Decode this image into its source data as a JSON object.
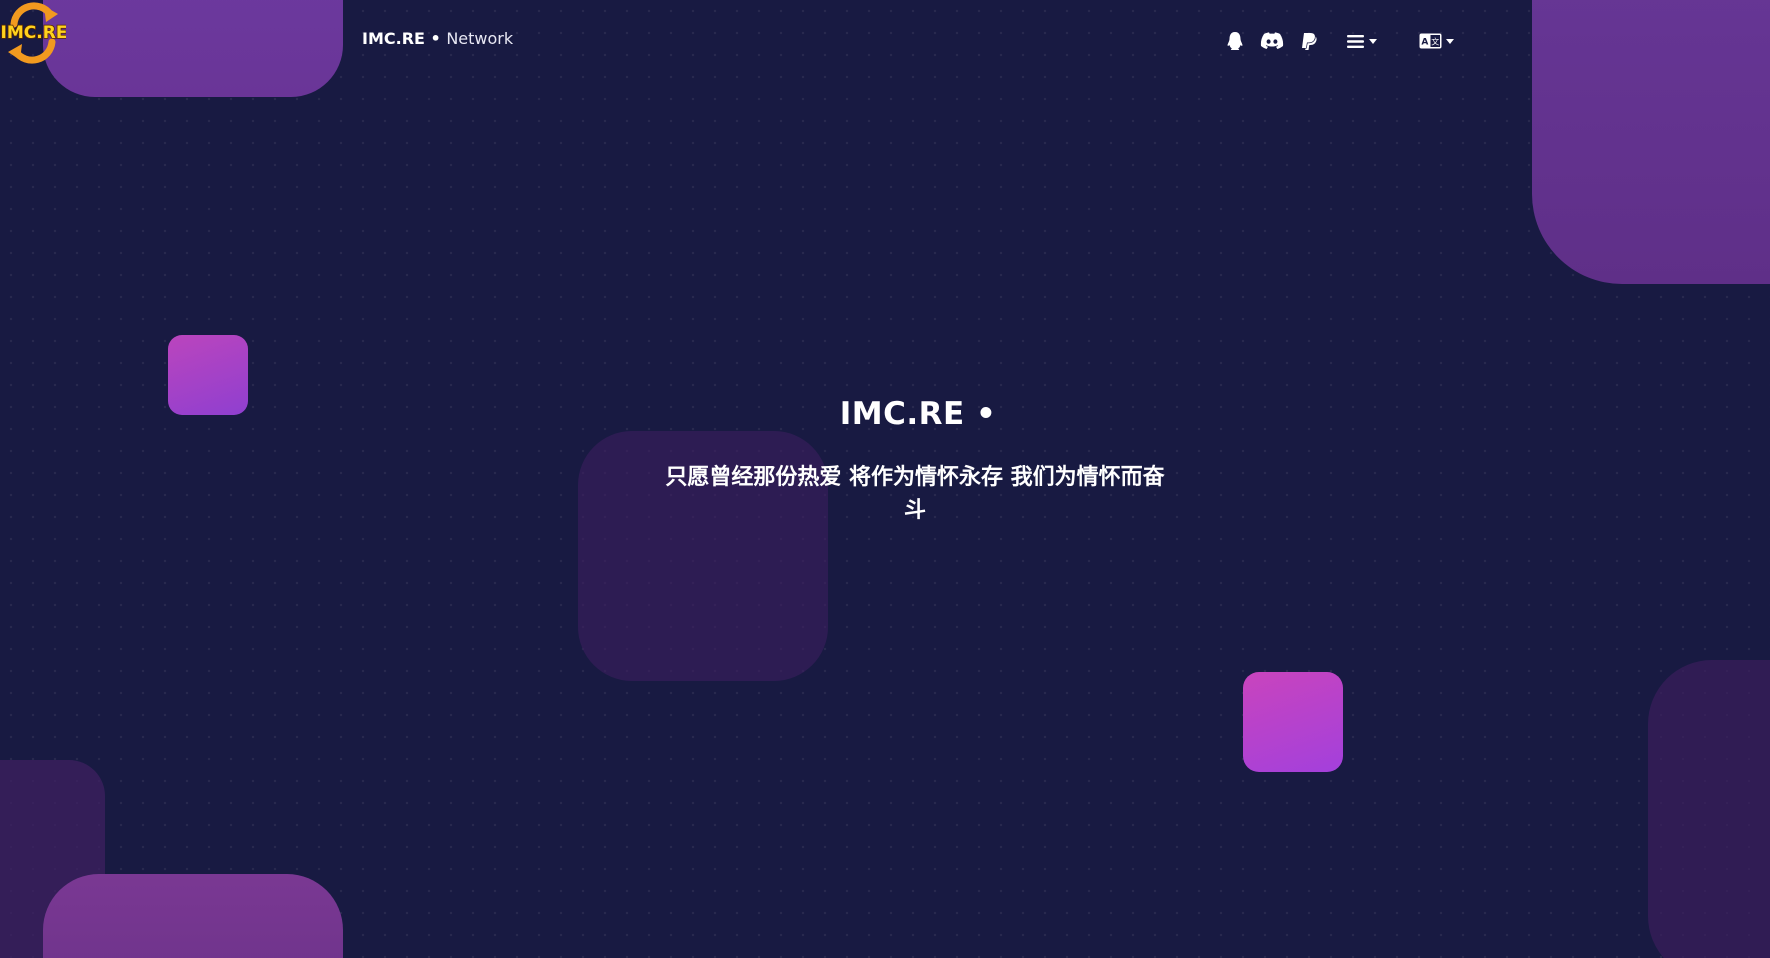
{
  "header": {
    "logo_text": "IMC.RE",
    "brand_name": "IMC.RE",
    "brand_separator": " • ",
    "brand_suffix": "Network"
  },
  "hero": {
    "title": "IMC.RE •",
    "subtitle": "只愿曾经那份热爱 将作为情怀永存 我们为情怀而奋斗"
  },
  "icons": {
    "qq": "qq-penguin-icon",
    "discord": "discord-icon",
    "paypal": "paypal-icon",
    "menu": "hamburger-menu-icon",
    "language": "language-translate-icon"
  },
  "colors": {
    "background": "#181a42",
    "accent_purple": "#6c3aa0",
    "accent_pink": "#c944bd",
    "logo_orange": "#f29a1f",
    "logo_yellow": "#ffd21e"
  }
}
